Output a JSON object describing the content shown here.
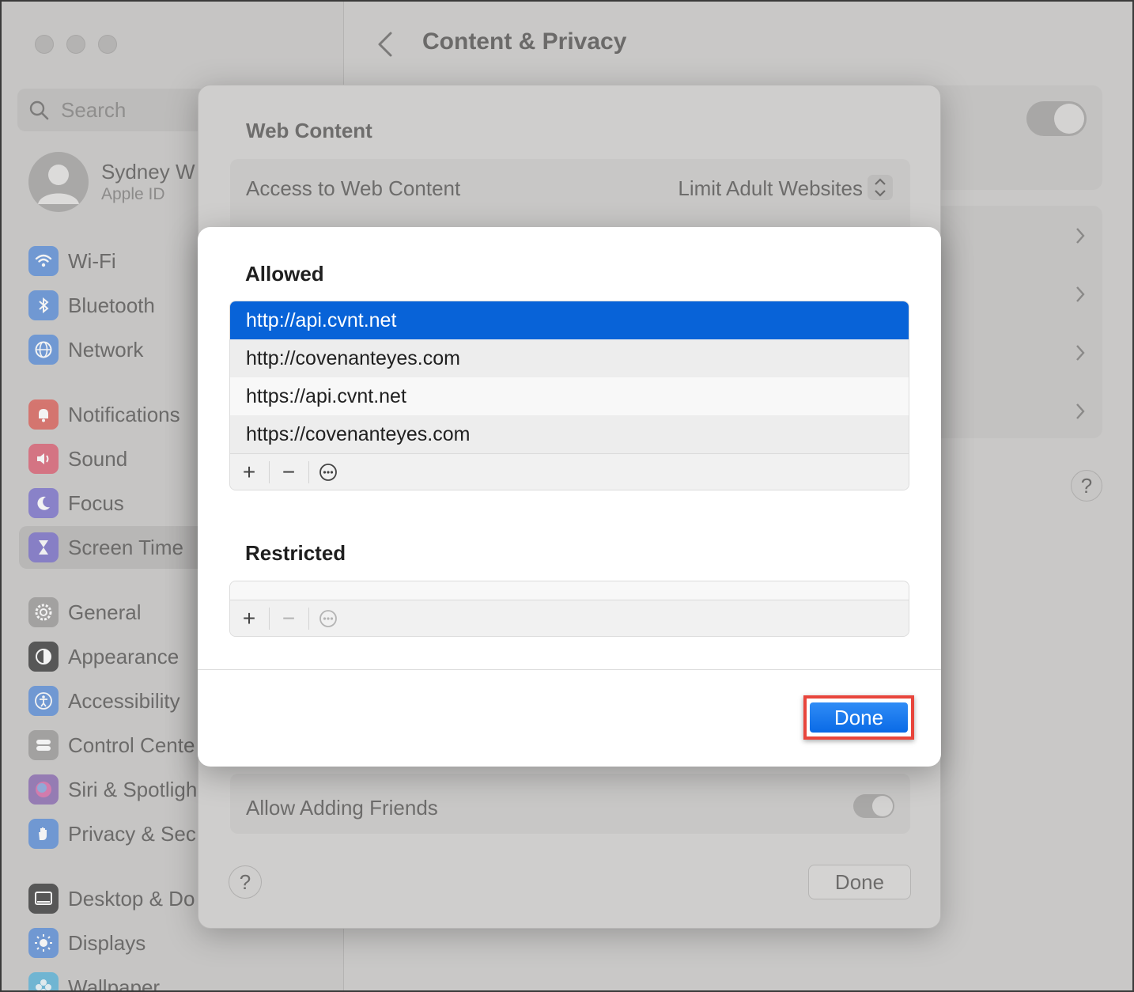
{
  "window": {
    "traffic_lights": [
      "close",
      "minimize",
      "zoom"
    ]
  },
  "sidebar": {
    "search_placeholder": "Search",
    "profile": {
      "name": "Sydney W",
      "subtitle": "Apple ID"
    },
    "items": [
      {
        "label": "Wi-Fi",
        "icon": "wifi-icon",
        "color": "#5b8ed6"
      },
      {
        "label": "Bluetooth",
        "icon": "bluetooth-icon",
        "color": "#5b8ed6"
      },
      {
        "label": "Network",
        "icon": "globe-icon",
        "color": "#5b8ed6"
      },
      {
        "label": "Notifications",
        "icon": "bell-icon",
        "color": "#d8625b"
      },
      {
        "label": "Sound",
        "icon": "speaker-icon",
        "color": "#d86073"
      },
      {
        "label": "Focus",
        "icon": "moon-icon",
        "color": "#7b72c9"
      },
      {
        "label": "Screen Time",
        "icon": "hourglass-icon",
        "color": "#7b72c9",
        "active": true
      },
      {
        "label": "General",
        "icon": "gear-icon",
        "color": "#9a9998"
      },
      {
        "label": "Appearance",
        "icon": "appearance-icon",
        "color": "#3c3c3c"
      },
      {
        "label": "Accessibility",
        "icon": "accessibility-icon",
        "color": "#5b8ed6"
      },
      {
        "label": "Control Cente",
        "icon": "control-center-icon",
        "color": "#9a9998"
      },
      {
        "label": "Siri & Spotligh",
        "icon": "siri-icon",
        "color": "#8a6bb0"
      },
      {
        "label": "Privacy & Sec",
        "icon": "hand-icon",
        "color": "#5b8ed6"
      },
      {
        "label": "Desktop & Do",
        "icon": "desktop-icon",
        "color": "#3c3c3c"
      },
      {
        "label": "Displays",
        "icon": "sun-icon",
        "color": "#5b8ed6"
      },
      {
        "label": "Wallpaper",
        "icon": "flower-icon",
        "color": "#5bb2d6"
      }
    ]
  },
  "main": {
    "title": "Content & Privacy"
  },
  "sheet": {
    "title": "Web Content",
    "access_label": "Access to Web Content",
    "access_value": "Limit Adult Websites",
    "friends_label": "Allow Adding Friends",
    "help_label": "?",
    "done_label": "Done"
  },
  "dialog": {
    "allowed_heading": "Allowed",
    "allowed_items": [
      "http://api.cvnt.net",
      "http://covenanteyes.com",
      "https://api.cvnt.net",
      "https://covenanteyes.com"
    ],
    "restricted_heading": "Restricted",
    "toolbar": {
      "add": "+",
      "remove": "−"
    },
    "done_label": "Done"
  },
  "background": {
    "help_label": "?"
  }
}
